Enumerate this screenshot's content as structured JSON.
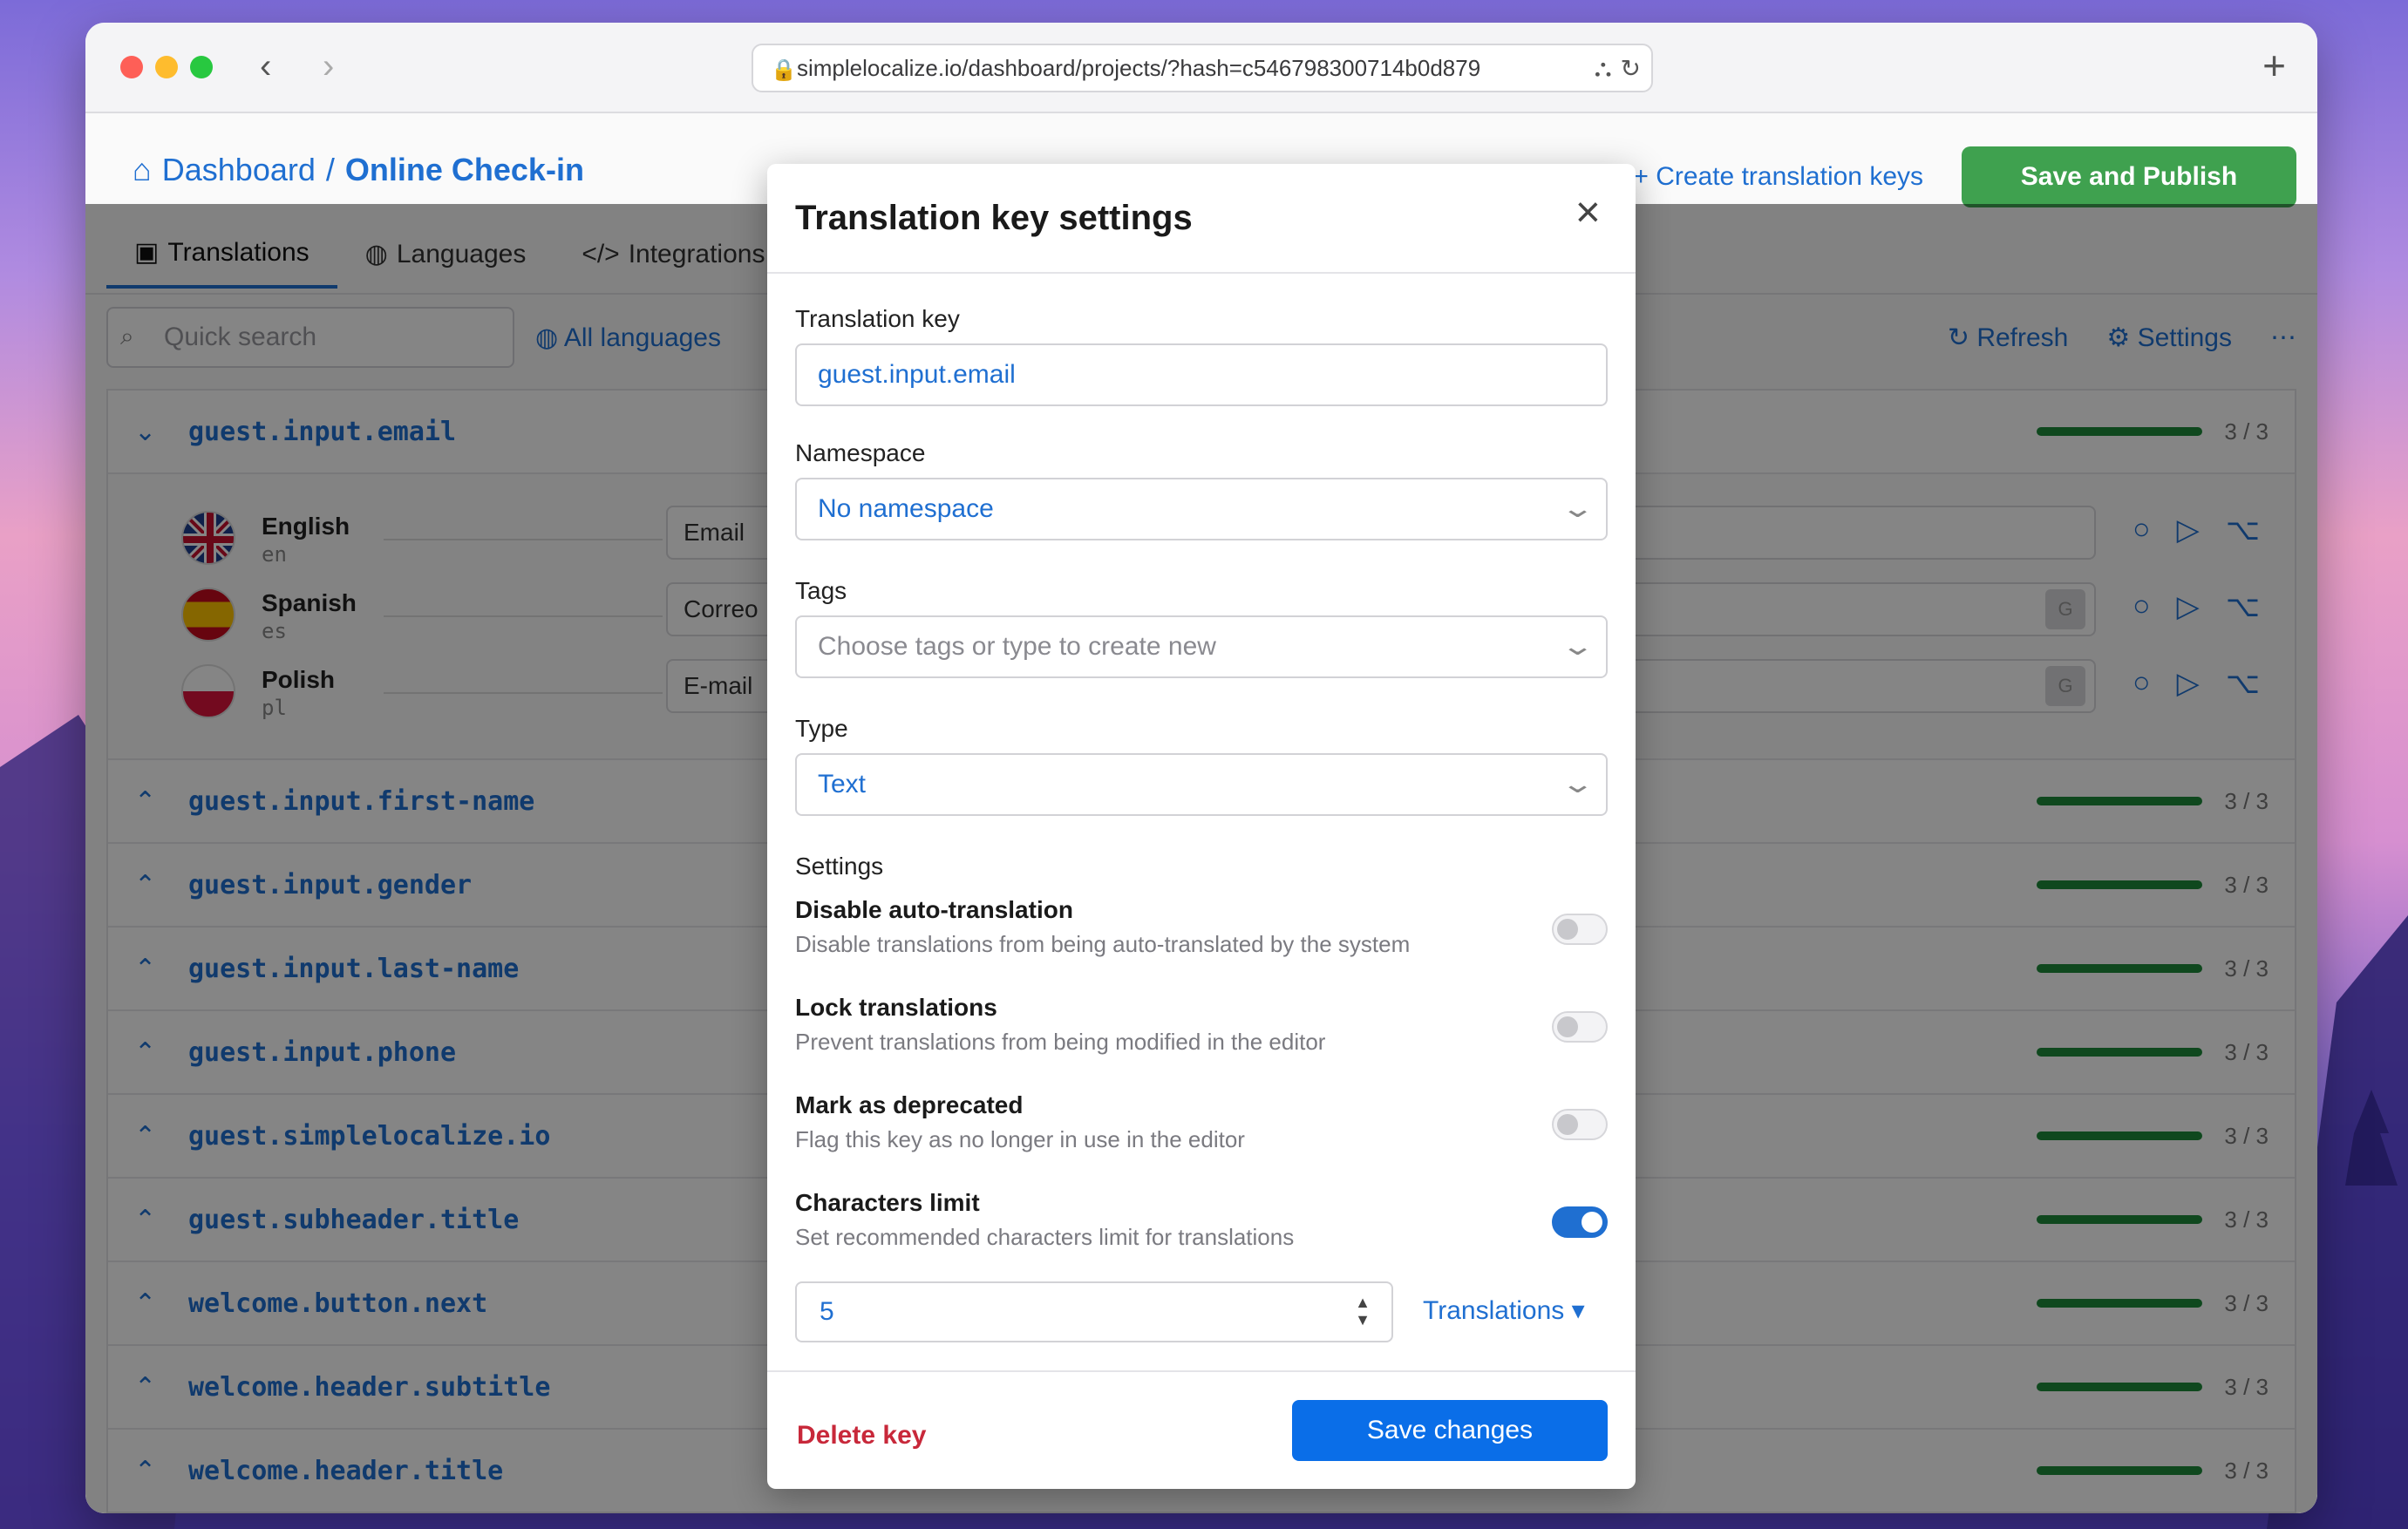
{
  "browser": {
    "url": "simplelocalize.io/dashboard/projects/?hash=c546798300714b0d879",
    "colors": {
      "close": "#fe5f57",
      "minimize": "#febc2e",
      "maximize": "#28c840"
    }
  },
  "header": {
    "breadcrumb_root": "Dashboard",
    "breadcrumb_sep": "/",
    "breadcrumb_current": "Online Check-in",
    "create_keys_label": "Create translation keys",
    "publish_label": "Save and Publish"
  },
  "tabs": [
    {
      "label": "Translations",
      "icon": "translations-icon",
      "active": true
    },
    {
      "label": "Languages",
      "icon": "globe-icon"
    },
    {
      "label": "Integrations",
      "icon": "code-icon"
    }
  ],
  "toolbar": {
    "search_placeholder": "Quick search",
    "languages_filter": "All languages",
    "refresh_label": "Refresh",
    "settings_label": "Settings"
  },
  "keys": {
    "expanded": {
      "key": "guest.input.email",
      "count": "3 / 3"
    },
    "languages": [
      {
        "name": "English",
        "code": "en",
        "value": "Email"
      },
      {
        "name": "Spanish",
        "code": "es",
        "value": "Correo"
      },
      {
        "name": "Polish",
        "code": "pl",
        "value": "E-mail"
      }
    ],
    "rows": [
      {
        "key": "guest.input.first-name",
        "count": "3 / 3"
      },
      {
        "key": "guest.input.gender",
        "count": "3 / 3"
      },
      {
        "key": "guest.input.last-name",
        "count": "3 / 3"
      },
      {
        "key": "guest.input.phone",
        "count": "3 / 3"
      },
      {
        "key": "guest.simplelocalize.io",
        "count": "3 / 3"
      },
      {
        "key": "guest.subheader.title",
        "count": "3 / 3"
      },
      {
        "key": "welcome.button.next",
        "count": "3 / 3"
      },
      {
        "key": "welcome.header.subtitle",
        "count": "3 / 3"
      },
      {
        "key": "welcome.header.title",
        "count": "3 / 3"
      }
    ]
  },
  "modal": {
    "title": "Translation key settings",
    "key_label": "Translation key",
    "key_value": "guest.input.email",
    "namespace_label": "Namespace",
    "namespace_value": "No namespace",
    "tags_label": "Tags",
    "tags_placeholder": "Choose tags or type to create new",
    "type_label": "Type",
    "type_value": "Text",
    "settings_heading": "Settings",
    "settings": [
      {
        "title": "Disable auto-translation",
        "desc": "Disable translations from being auto-translated by the system",
        "enabled": false
      },
      {
        "title": "Lock translations",
        "desc": "Prevent translations from being modified in the editor",
        "enabled": false
      },
      {
        "title": "Mark as deprecated",
        "desc": "Flag this key as no longer in use in the editor",
        "enabled": false
      },
      {
        "title": "Characters limit",
        "desc": "Set recommended characters limit for translations",
        "enabled": true
      }
    ],
    "char_limit_value": "5",
    "limit_scope": "Translations",
    "delete_label": "Delete key",
    "save_label": "Save changes"
  }
}
